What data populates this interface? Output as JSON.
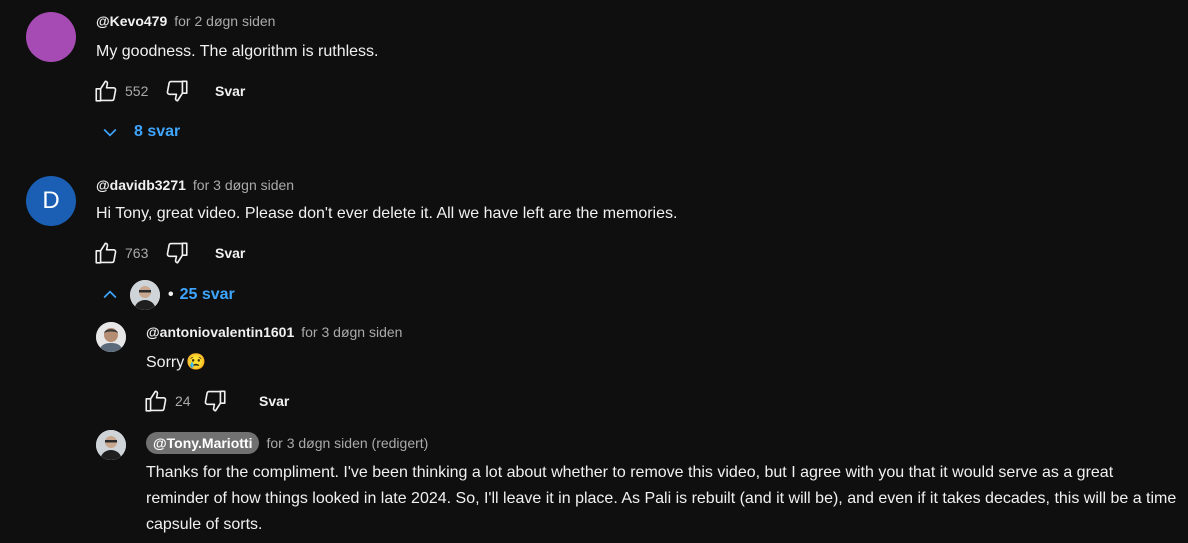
{
  "comments": [
    {
      "author": "@Kevo479",
      "time": "for 2 døgn siden",
      "text": "My goodness. The algorithm is ruthless.",
      "likes": "552",
      "reply_label": "Svar",
      "replies_label": "8 svar",
      "avatar_color": "#a64bb4"
    },
    {
      "author": "@davidb3271",
      "time": "for 3 døgn siden",
      "text": "Hi Tony, great video. Please don't ever delete it. All we have left are the memories.",
      "likes": "763",
      "reply_label": "Svar",
      "replies_label": "25 svar",
      "avatar_letter": "D",
      "avatar_color": "#1a5fb4",
      "replies": [
        {
          "author": "@antoniovalentin1601",
          "time": "for 3 døgn siden",
          "text": "Sorry",
          "emoji": "😢",
          "likes": "24",
          "reply_label": "Svar"
        },
        {
          "author": "@Tony.Mariotti",
          "time": "for 3 døgn siden (redigert)",
          "text": "Thanks for the compliment. I've been thinking a lot about whether to remove this video, but I agree with you that it would serve as a great reminder of how things looked in late 2024. So, I'll leave it in place. As Pali is rebuilt (and it will be), and even if it takes decades, this will be a time capsule of sorts."
        }
      ]
    }
  ],
  "colors": {
    "background": "#0f0f0f",
    "link_blue": "#3ea6ff",
    "muted": "#aaaaaa"
  }
}
